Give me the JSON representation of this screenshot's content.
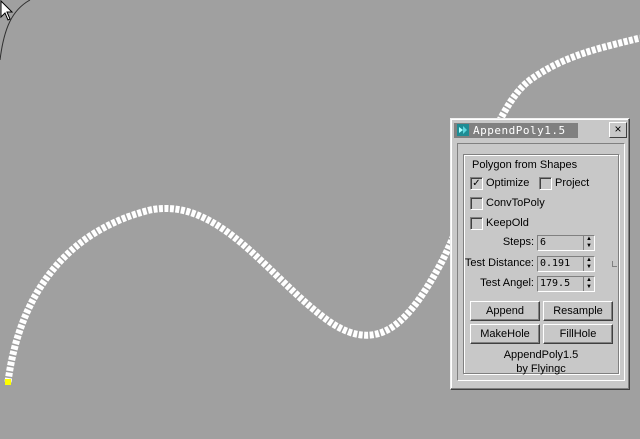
{
  "dialog": {
    "title": "AppendPoly1.5",
    "close_label": "×",
    "group_label": "Polygon from Shapes",
    "checkboxes": [
      {
        "label": "Optimize",
        "checked": true
      },
      {
        "label": "Project",
        "checked": false
      },
      {
        "label": "ConvToPoly",
        "checked": false
      },
      {
        "label": "KeepOld",
        "checked": false
      }
    ],
    "spinners": [
      {
        "label": "Steps:",
        "value": "6"
      },
      {
        "label": "Test Distance:",
        "value": "0.191"
      },
      {
        "label": "Test Angel:",
        "value": "179.5"
      }
    ],
    "buttons": {
      "append": "Append",
      "resample": "Resample",
      "makehole": "MakeHole",
      "fillhole": "FillHole"
    },
    "footer": {
      "line1": "AppendPoly1.5",
      "line2": "by Flyingc"
    }
  },
  "colors": {
    "viewport_bg": "#a0a0a0",
    "spline": "#ffffff",
    "start_vertex": "#ffff00",
    "dialog_bg": "#c8c8c8",
    "title_strip": "#808080"
  },
  "icons": [
    "maxscript-icon",
    "close-icon",
    "mouse-cursor-icon",
    "spinner-arrows-icon",
    "checkmark-icon"
  ]
}
